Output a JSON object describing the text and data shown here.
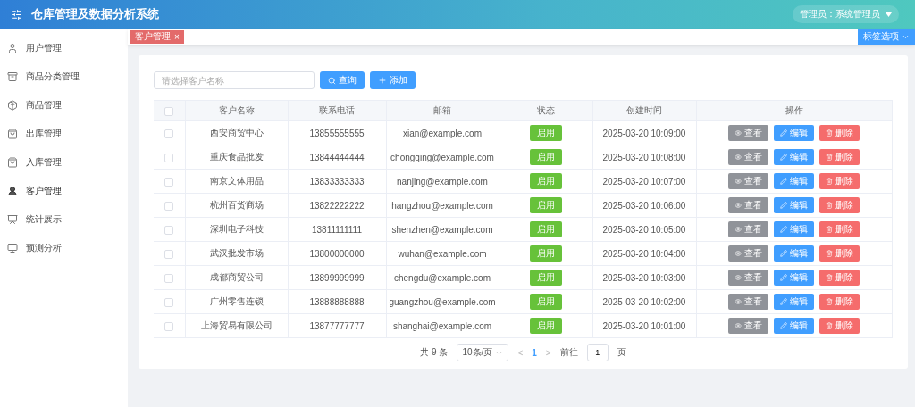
{
  "header": {
    "title": "仓库管理及数据分析系统",
    "user": "管理员：系统管理员"
  },
  "sidebar": {
    "items": [
      {
        "label": "用户管理",
        "kind": "user",
        "selected": false
      },
      {
        "label": "商品分类管理",
        "kind": "category",
        "selected": false
      },
      {
        "label": "商品管理",
        "kind": "goods",
        "selected": false
      },
      {
        "label": "出库管理",
        "kind": "outbound",
        "selected": false
      },
      {
        "label": "入库管理",
        "kind": "inbound",
        "selected": false
      },
      {
        "label": "客户管理",
        "kind": "customer",
        "selected": true
      },
      {
        "label": "统计展示",
        "kind": "stats",
        "selected": false
      },
      {
        "label": "预测分析",
        "kind": "forecast",
        "selected": false
      }
    ]
  },
  "tags": [
    {
      "label": "客户管理",
      "close": "×",
      "selected": true
    }
  ],
  "tag_options": "标签选项",
  "search": {
    "placeholder": "请选择客户名称"
  },
  "buttons": {
    "query": "查询",
    "add": "添加"
  },
  "table": {
    "select_all_checked": false,
    "columns": [
      "客户名称",
      "联系电话",
      "邮箱",
      "状态",
      "创建时间",
      "操作"
    ],
    "rows": [
      {
        "checked": false,
        "name": "西安商贸中心",
        "phone": "13855555555",
        "email": "xian@example.com",
        "status": "启用",
        "created": "2025-03-20 10:09:00",
        "actions": [
          {
            "kind": "view",
            "label": "查看"
          },
          {
            "kind": "edit",
            "label": "编辑"
          },
          {
            "kind": "delete",
            "label": "删除"
          }
        ]
      },
      {
        "checked": false,
        "name": "重庆食品批发",
        "phone": "13844444444",
        "email": "chongqing@example.com",
        "status": "启用",
        "created": "2025-03-20 10:08:00",
        "actions": [
          {
            "kind": "view",
            "label": "查看"
          },
          {
            "kind": "edit",
            "label": "编辑"
          },
          {
            "kind": "delete",
            "label": "删除"
          }
        ]
      },
      {
        "checked": false,
        "name": "南京文体用品",
        "phone": "13833333333",
        "email": "nanjing@example.com",
        "status": "启用",
        "created": "2025-03-20 10:07:00",
        "actions": [
          {
            "kind": "view",
            "label": "查看"
          },
          {
            "kind": "edit",
            "label": "编辑"
          },
          {
            "kind": "delete",
            "label": "删除"
          }
        ]
      },
      {
        "checked": false,
        "name": "杭州百货商场",
        "phone": "13822222222",
        "email": "hangzhou@example.com",
        "status": "启用",
        "created": "2025-03-20 10:06:00",
        "actions": [
          {
            "kind": "view",
            "label": "查看"
          },
          {
            "kind": "edit",
            "label": "编辑"
          },
          {
            "kind": "delete",
            "label": "删除"
          }
        ]
      },
      {
        "checked": false,
        "name": "深圳电子科技",
        "phone": "13811111111",
        "email": "shenzhen@example.com",
        "status": "启用",
        "created": "2025-03-20 10:05:00",
        "actions": [
          {
            "kind": "view",
            "label": "查看"
          },
          {
            "kind": "edit",
            "label": "编辑"
          },
          {
            "kind": "delete",
            "label": "删除"
          }
        ]
      },
      {
        "checked": false,
        "name": "武汉批发市场",
        "phone": "13800000000",
        "email": "wuhan@example.com",
        "status": "启用",
        "created": "2025-03-20 10:04:00",
        "actions": [
          {
            "kind": "view",
            "label": "查看"
          },
          {
            "kind": "edit",
            "label": "编辑"
          },
          {
            "kind": "delete",
            "label": "删除"
          }
        ]
      },
      {
        "checked": false,
        "name": "成都商贸公司",
        "phone": "13899999999",
        "email": "chengdu@example.com",
        "status": "启用",
        "created": "2025-03-20 10:03:00",
        "actions": [
          {
            "kind": "view",
            "label": "查看"
          },
          {
            "kind": "edit",
            "label": "编辑"
          },
          {
            "kind": "delete",
            "label": "删除"
          }
        ]
      },
      {
        "checked": false,
        "name": "广州零售连锁",
        "phone": "13888888888",
        "email": "guangzhou@example.com",
        "status": "启用",
        "created": "2025-03-20 10:02:00",
        "actions": [
          {
            "kind": "view",
            "label": "查看"
          },
          {
            "kind": "edit",
            "label": "编辑"
          },
          {
            "kind": "delete",
            "label": "删除"
          }
        ]
      },
      {
        "checked": false,
        "name": "上海贸易有限公司",
        "phone": "13877777777",
        "email": "shanghai@example.com",
        "status": "启用",
        "created": "2025-03-20 10:01:00",
        "actions": [
          {
            "kind": "view",
            "label": "查看"
          },
          {
            "kind": "edit",
            "label": "编辑"
          },
          {
            "kind": "delete",
            "label": "删除"
          }
        ]
      }
    ]
  },
  "pagination": {
    "total": "共 9 条",
    "page_size": "10条/页",
    "prev": "<",
    "pages": [
      {
        "label": "1",
        "selected": true
      }
    ],
    "next": ">",
    "goto": "前往",
    "goto_value": "1",
    "page_unit": "页"
  }
}
